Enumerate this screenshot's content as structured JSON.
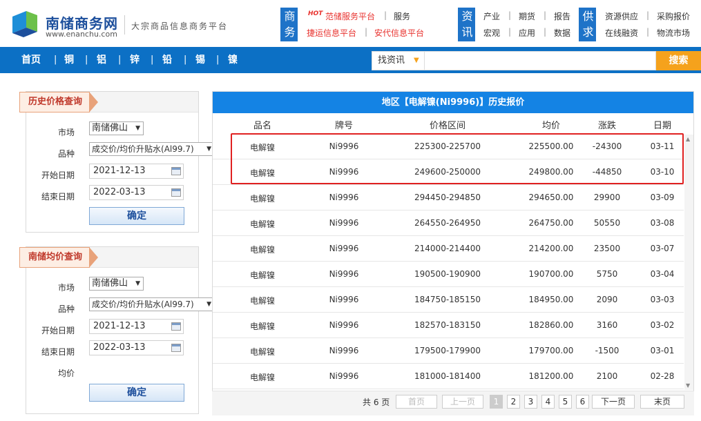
{
  "header": {
    "logo_cn": "南储商务网",
    "logo_en": "www.enanchu.com",
    "slogan": "大宗商品信息商务平台",
    "groups": [
      {
        "badge": "商务",
        "links": [
          "范储服务平台",
          "服务",
          "捷运信息平台",
          "安代信息平台"
        ],
        "hot": "HOT"
      },
      {
        "badge": "资讯",
        "links": [
          "产业",
          "期货",
          "报告",
          "宏观",
          "应用",
          "数据"
        ]
      },
      {
        "badge": "供求",
        "links": [
          "资源供应",
          "采购报价",
          "在线融资",
          "物流市场"
        ]
      }
    ]
  },
  "nav": {
    "items": [
      "首页",
      "铜",
      "铝",
      "锌",
      "铅",
      "锡",
      "镍"
    ],
    "separator": "|"
  },
  "search": {
    "type": "找资讯",
    "placeholder": "",
    "button": "搜索"
  },
  "history_panel": {
    "title": "历史价格查询",
    "market_label": "市场",
    "market_value": "南储佛山",
    "variety_label": "品种",
    "variety_value": "成交价/均价升贴水(Al99.7)",
    "start_label": "开始日期",
    "start_value": "2021-12-13",
    "end_label": "结束日期",
    "end_value": "2022-03-13",
    "confirm": "确定"
  },
  "avg_panel": {
    "title": "南储均价查询",
    "market_label": "市场",
    "market_value": "南储佛山",
    "variety_label": "品种",
    "variety_value": "成交价/均价升贴水(Al99.7)",
    "start_label": "开始日期",
    "start_value": "2021-12-13",
    "end_label": "结束日期",
    "end_value": "2022-03-13",
    "avg_label": "均价",
    "confirm": "确定"
  },
  "table": {
    "title": "地区【电解镍(Ni9996)】历史报价",
    "columns": [
      "品名",
      "牌号",
      "价格区间",
      "均价",
      "涨跌",
      "日期"
    ],
    "rows": [
      [
        "电解镍",
        "Ni9996",
        "225300-225700",
        "225500.00",
        "-24300",
        "03-11"
      ],
      [
        "电解镍",
        "Ni9996",
        "249600-250000",
        "249800.00",
        "-44850",
        "03-10"
      ],
      [
        "电解镍",
        "Ni9996",
        "294450-294850",
        "294650.00",
        "29900",
        "03-09"
      ],
      [
        "电解镍",
        "Ni9996",
        "264550-264950",
        "264750.00",
        "50550",
        "03-08"
      ],
      [
        "电解镍",
        "Ni9996",
        "214000-214400",
        "214200.00",
        "23500",
        "03-07"
      ],
      [
        "电解镍",
        "Ni9996",
        "190500-190900",
        "190700.00",
        "5750",
        "03-04"
      ],
      [
        "电解镍",
        "Ni9996",
        "184750-185150",
        "184950.00",
        "2090",
        "03-03"
      ],
      [
        "电解镍",
        "Ni9996",
        "182570-183150",
        "182860.00",
        "3160",
        "03-02"
      ],
      [
        "电解镍",
        "Ni9996",
        "179500-179900",
        "179700.00",
        "-1500",
        "03-01"
      ],
      [
        "电解镍",
        "Ni9996",
        "181000-181400",
        "181200.00",
        "2100",
        "02-28"
      ]
    ]
  },
  "pager": {
    "total": "共 6 页",
    "first": "首页",
    "prev": "上一页",
    "pages": [
      "1",
      "2",
      "3",
      "4",
      "5",
      "6"
    ],
    "current": "1",
    "next": "下一页",
    "last": "末页"
  },
  "colors": {
    "nav_bg": "#0c70c5",
    "search_btn": "#f5a21c",
    "table_title_bg": "#1483e4",
    "highlight": "#e02020"
  }
}
